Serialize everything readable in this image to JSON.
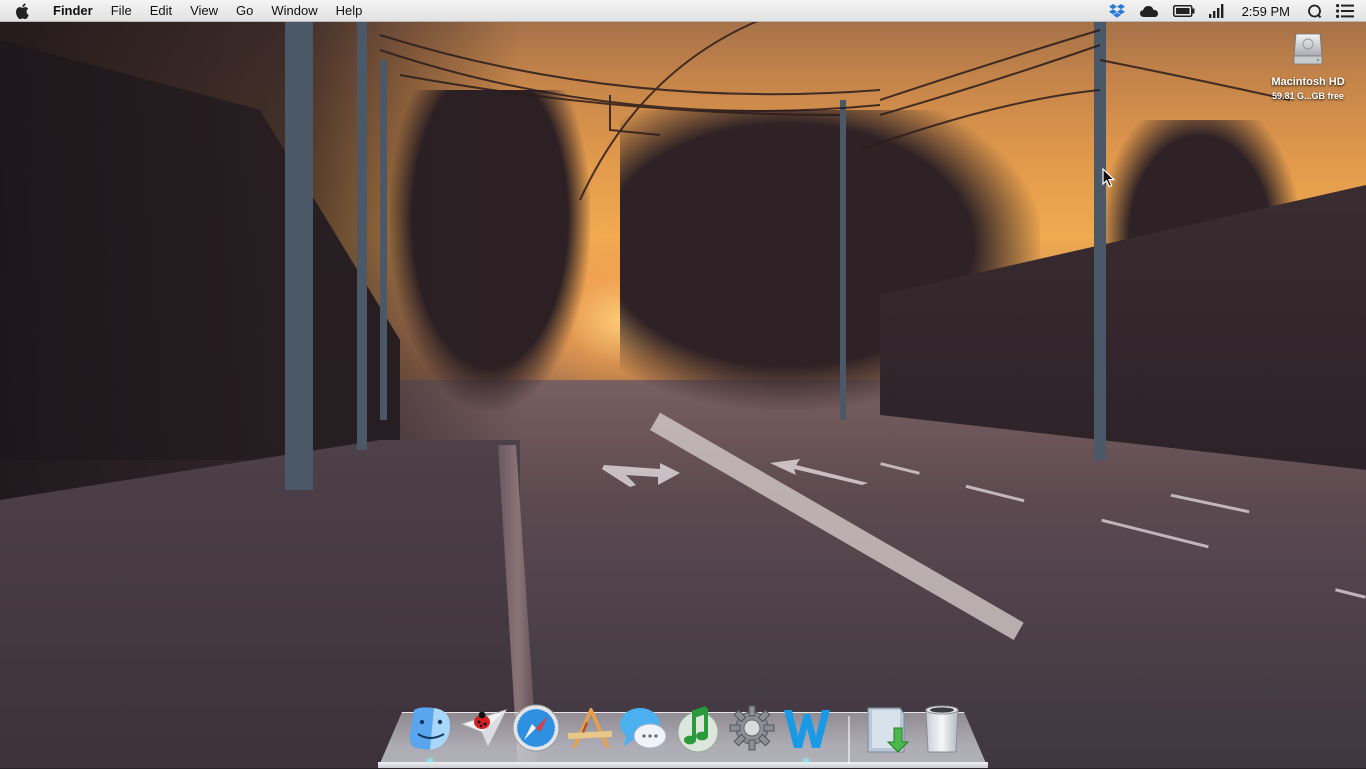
{
  "menubar": {
    "app_name": "Finder",
    "menus": [
      "File",
      "Edit",
      "View",
      "Go",
      "Window",
      "Help"
    ],
    "status_icons": [
      "dropbox-icon",
      "icloud-icon",
      "battery-icon",
      "signal-icon"
    ],
    "clock": "2:59 PM",
    "right_icons": [
      "spotlight-icon",
      "notification-center-icon"
    ]
  },
  "desktop": {
    "drive_name": "Macintosh HD",
    "drive_info": "59.81 G...GB free"
  },
  "dock": {
    "apps": [
      {
        "name": "finder-icon"
      },
      {
        "name": "sparrow-icon"
      },
      {
        "name": "safari-icon"
      },
      {
        "name": "textedit-icon"
      },
      {
        "name": "messages-icon"
      },
      {
        "name": "itunes-icon"
      },
      {
        "name": "system-preferences-icon"
      },
      {
        "name": "word-icon"
      }
    ],
    "stacks": [
      {
        "name": "downloads-stack-icon"
      },
      {
        "name": "trash-icon"
      }
    ]
  },
  "colors": {
    "menubar": "#e8e8e8",
    "sky": "#f0aa50",
    "road": "#4a3e46"
  }
}
